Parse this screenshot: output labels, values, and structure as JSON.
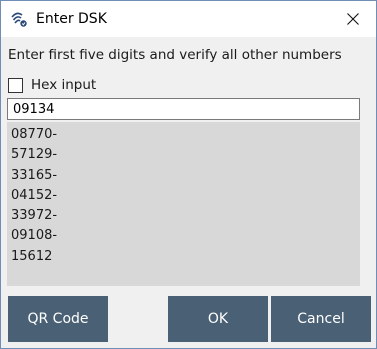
{
  "window": {
    "title": "Enter DSK",
    "icon": "zwave-icon",
    "close_icon": "close-icon"
  },
  "dialog": {
    "instruction": "Enter first five digits and verify all other numbers",
    "hex_checkbox": {
      "label": "Hex input",
      "checked": false
    },
    "dsk_input": {
      "value": "09134"
    },
    "dsk_numbers": [
      "08770-",
      "57129-",
      "33165-",
      "04152-",
      "33972-",
      "09108-",
      "15612"
    ]
  },
  "buttons": {
    "qr_code": "QR Code",
    "ok": "OK",
    "cancel": "Cancel"
  },
  "colors": {
    "button_bg": "#4a6075",
    "content_bg": "#f0f0f0",
    "numbers_bg": "#d8d8d8",
    "border": "#6f8db5"
  }
}
